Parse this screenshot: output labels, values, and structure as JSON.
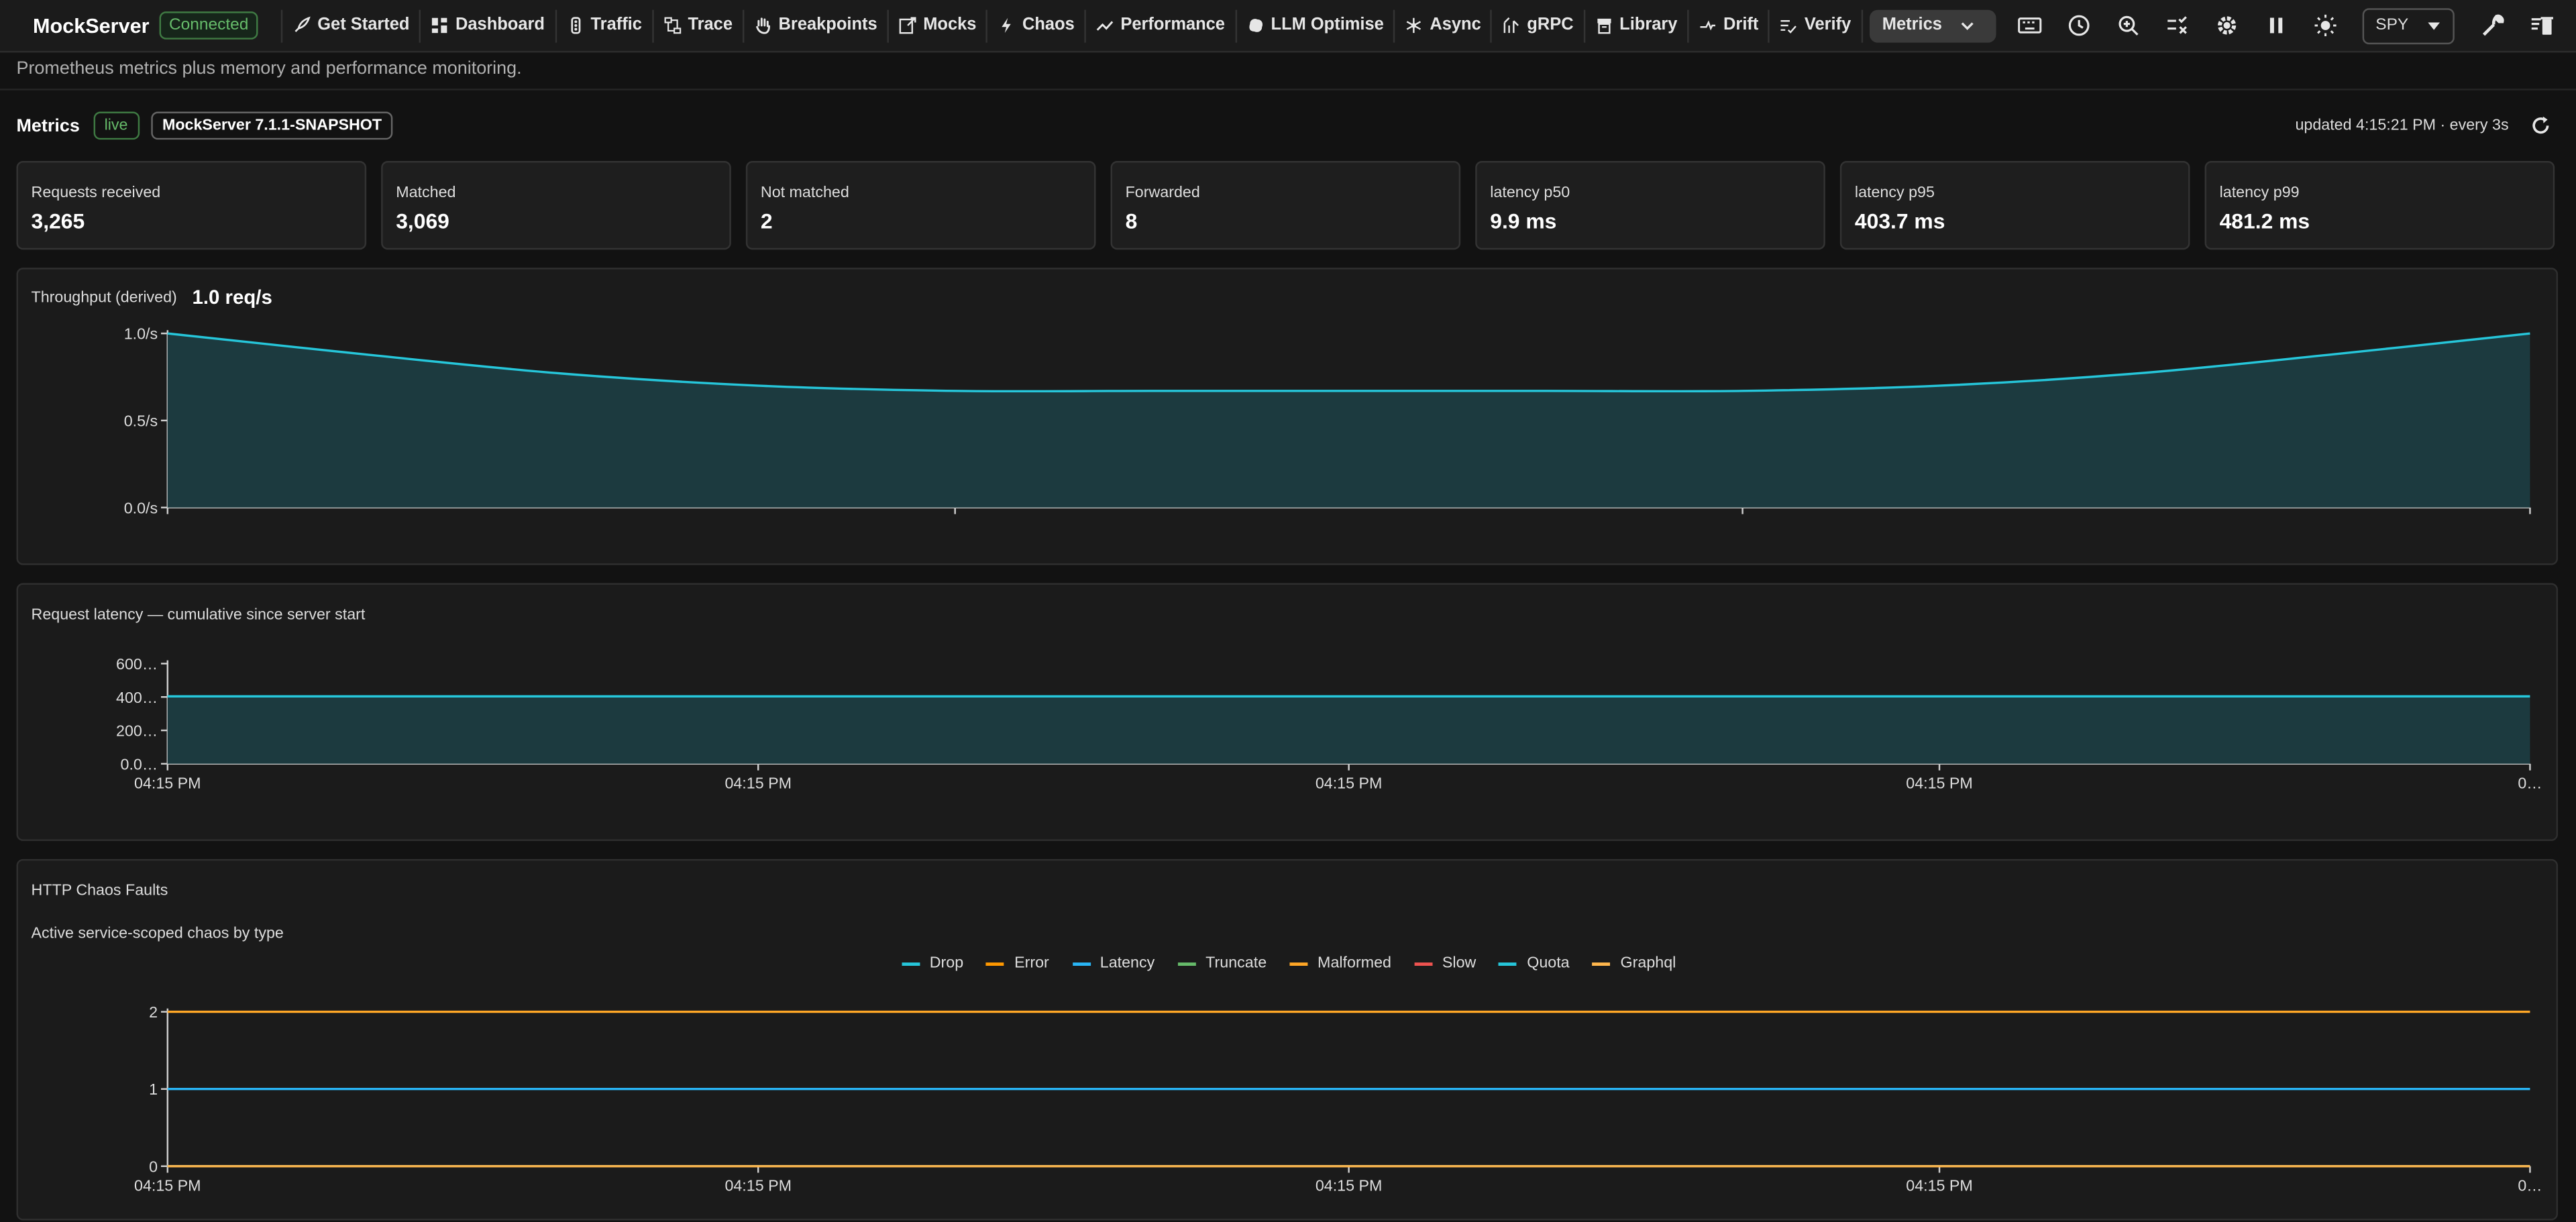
{
  "app": {
    "name": "MockServer",
    "status": "Connected"
  },
  "nav": {
    "items": [
      {
        "label": "Get Started",
        "icon": "rocket-icon"
      },
      {
        "label": "Dashboard",
        "icon": "dashboard-icon"
      },
      {
        "label": "Traffic",
        "icon": "traffic-icon"
      },
      {
        "label": "Trace",
        "icon": "trace-icon"
      },
      {
        "label": "Breakpoints",
        "icon": "hand-icon"
      },
      {
        "label": "Mocks",
        "icon": "mocks-icon"
      },
      {
        "label": "Chaos",
        "icon": "bolt-icon"
      },
      {
        "label": "Performance",
        "icon": "trend-icon"
      },
      {
        "label": "LLM Optimise",
        "icon": "llm-icon"
      },
      {
        "label": "Async",
        "icon": "async-icon"
      },
      {
        "label": "gRPC",
        "icon": "grpc-icon"
      },
      {
        "label": "Library",
        "icon": "library-icon"
      },
      {
        "label": "Drift",
        "icon": "drift-icon"
      },
      {
        "label": "Verify",
        "icon": "verify-icon"
      }
    ],
    "active": "Metrics"
  },
  "toolbar": {
    "icons": [
      "keyboard-icon",
      "history-icon",
      "zoom-search-icon",
      "checklist-icon",
      "settings-icon",
      "pause-icon",
      "brightness-icon"
    ],
    "mode": "SPY",
    "right_icons": [
      "wrench-icon",
      "clear-icon"
    ]
  },
  "page": {
    "subtitle": "Prometheus metrics plus memory and performance monitoring.",
    "title": "Metrics",
    "live": "live",
    "version": "MockServer 7.1.1-SNAPSHOT",
    "updated": "updated 4:15:21 PM · every 3s"
  },
  "stats": [
    {
      "label": "Requests received",
      "value": "3,265"
    },
    {
      "label": "Matched",
      "value": "3,069"
    },
    {
      "label": "Not matched",
      "value": "2"
    },
    {
      "label": "Forwarded",
      "value": "8"
    },
    {
      "label": "latency p50",
      "value": "9.9 ms"
    },
    {
      "label": "latency p95",
      "value": "403.7 ms"
    },
    {
      "label": "latency p99",
      "value": "481.2 ms"
    }
  ],
  "throughput": {
    "title": "Throughput (derived)",
    "rate": "1.0 req/s"
  },
  "latency": {
    "title": "Request latency — cumulative since server start"
  },
  "chaos": {
    "title": "HTTP Chaos Faults",
    "subtitle": "Active service-scoped chaos by type"
  },
  "colors": {
    "cyan": "#26c6da",
    "fill": "#1c3a3f",
    "orange": "#ff9800",
    "green": "#66bb6a",
    "red": "#ef5350"
  },
  "chart_data": [
    {
      "type": "area",
      "title": "Throughput (derived)",
      "ylim": [
        0,
        1.0
      ],
      "yticks": [
        "1.0/s",
        "0.5/s",
        "0.0/s"
      ],
      "x": [
        0,
        1,
        2,
        3,
        4,
        5,
        6,
        7,
        8,
        9,
        10,
        11,
        12
      ],
      "values": [
        1.0,
        0.88,
        0.77,
        0.7,
        0.67,
        0.67,
        0.67,
        0.67,
        0.67,
        0.7,
        0.77,
        0.88,
        1.0
      ]
    },
    {
      "type": "area",
      "title": "Request latency — cumulative since server start",
      "ylim": [
        0,
        600
      ],
      "yticks": [
        "600…",
        "400…",
        "200…",
        "0.0…"
      ],
      "xticks": [
        "04:15 PM",
        "04:15 PM",
        "04:15 PM",
        "04:15 PM",
        "0…"
      ],
      "x": [
        0,
        1
      ],
      "values": [
        403.7,
        403.7
      ]
    },
    {
      "type": "line",
      "title": "HTTP Chaos Faults",
      "subtitle": "Active service-scoped chaos by type",
      "ylim": [
        0,
        2
      ],
      "yticks": [
        "2",
        "1",
        "0"
      ],
      "xticks": [
        "04:15 PM",
        "04:15 PM",
        "04:15 PM",
        "04:15 PM",
        "0…"
      ],
      "x": [
        0,
        1
      ],
      "series": [
        {
          "name": "Drop",
          "color": "#26c6da",
          "values": [
            0,
            0
          ]
        },
        {
          "name": "Error",
          "color": "#ff9800",
          "values": [
            0,
            0
          ]
        },
        {
          "name": "Latency",
          "color": "#29b6f6",
          "values": [
            1,
            1
          ]
        },
        {
          "name": "Truncate",
          "color": "#66bb6a",
          "values": [
            0,
            0
          ]
        },
        {
          "name": "Malformed",
          "color": "#ffa726",
          "values": [
            2,
            2
          ]
        },
        {
          "name": "Slow",
          "color": "#ef5350",
          "values": [
            0,
            0
          ]
        },
        {
          "name": "Quota",
          "color": "#26c6da",
          "values": [
            0,
            0
          ]
        },
        {
          "name": "Graphql",
          "color": "#ffb74d",
          "values": [
            0,
            0
          ]
        }
      ]
    }
  ]
}
